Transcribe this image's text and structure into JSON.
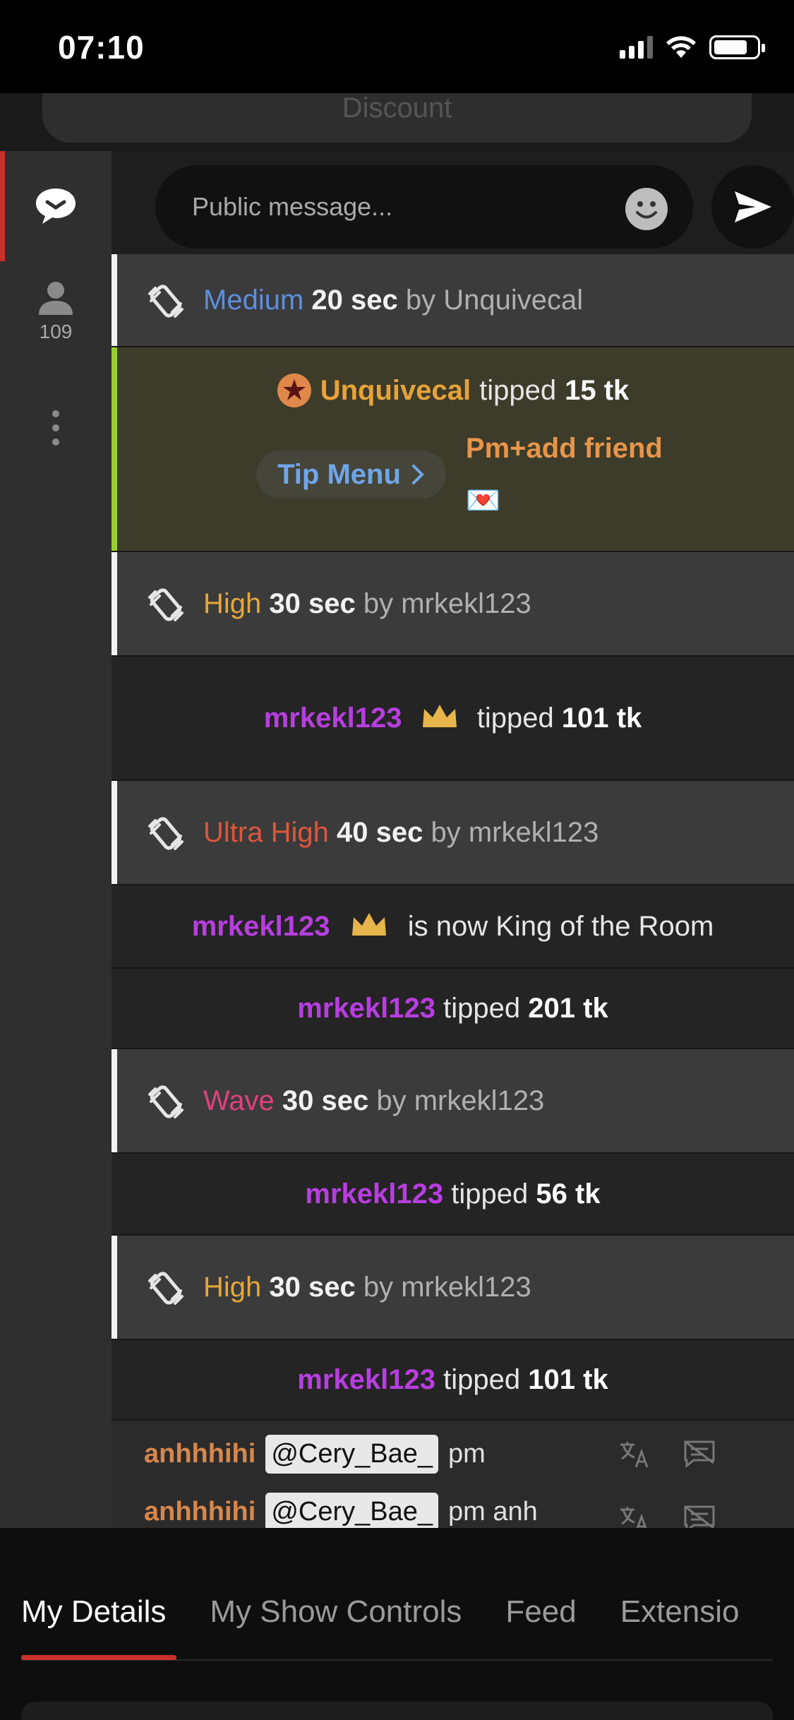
{
  "status_bar": {
    "time": "07:10"
  },
  "discount": {
    "label": "Discount"
  },
  "left_rail": {
    "users_count": "109"
  },
  "composer": {
    "placeholder": "Public message..."
  },
  "chat": {
    "vibe_medium": {
      "level": "Medium",
      "duration": "20 sec",
      "by": "by",
      "user": "Unquivecal",
      "color": "#5b8fe0"
    },
    "featured_tip": {
      "user": "Unquivecal",
      "tipped": "tipped",
      "amount": "15 tk",
      "tip_menu_label": "Tip Menu",
      "message": "Pm+add friend",
      "envelope": "💌"
    },
    "vibe_high_1": {
      "level": "High",
      "duration": "30 sec",
      "by": "by",
      "user": "mrkekl123",
      "color": "#e5a73a"
    },
    "tip_101_a": {
      "user": "mrkekl123",
      "tipped": "tipped",
      "amount_num": "101",
      "amount_unit": "tk"
    },
    "vibe_ultra": {
      "level": "Ultra High",
      "duration": "40 sec",
      "by": "by",
      "user": "mrkekl123",
      "color": "#e0553a"
    },
    "king": {
      "user": "mrkekl123",
      "text": "is now King of the Room"
    },
    "tip_201": {
      "user": "mrkekl123",
      "tipped": "tipped",
      "amount": "201 tk"
    },
    "vibe_wave": {
      "level": "Wave",
      "duration": "30 sec",
      "by": "by",
      "user": "mrkekl123",
      "color": "#e0407e"
    },
    "tip_56": {
      "user": "mrkekl123",
      "tipped": "tipped",
      "amount": "56 tk"
    },
    "vibe_high_2": {
      "level": "High",
      "duration": "30 sec",
      "by": "by",
      "user": "mrkekl123",
      "color": "#e5a73a"
    },
    "tip_101_b": {
      "user": "mrkekl123",
      "tipped": "tipped",
      "amount": "101 tk"
    },
    "message_1": {
      "user": "anhhhihi",
      "mention": "@Cery_Bae_",
      "text": "pm"
    },
    "message_2": {
      "user": "anhhhihi",
      "mention": "@Cery_Bae_",
      "text": "pm anh"
    }
  },
  "tabs": [
    "My Details",
    "My Show Controls",
    "Feed",
    "Extensio"
  ]
}
